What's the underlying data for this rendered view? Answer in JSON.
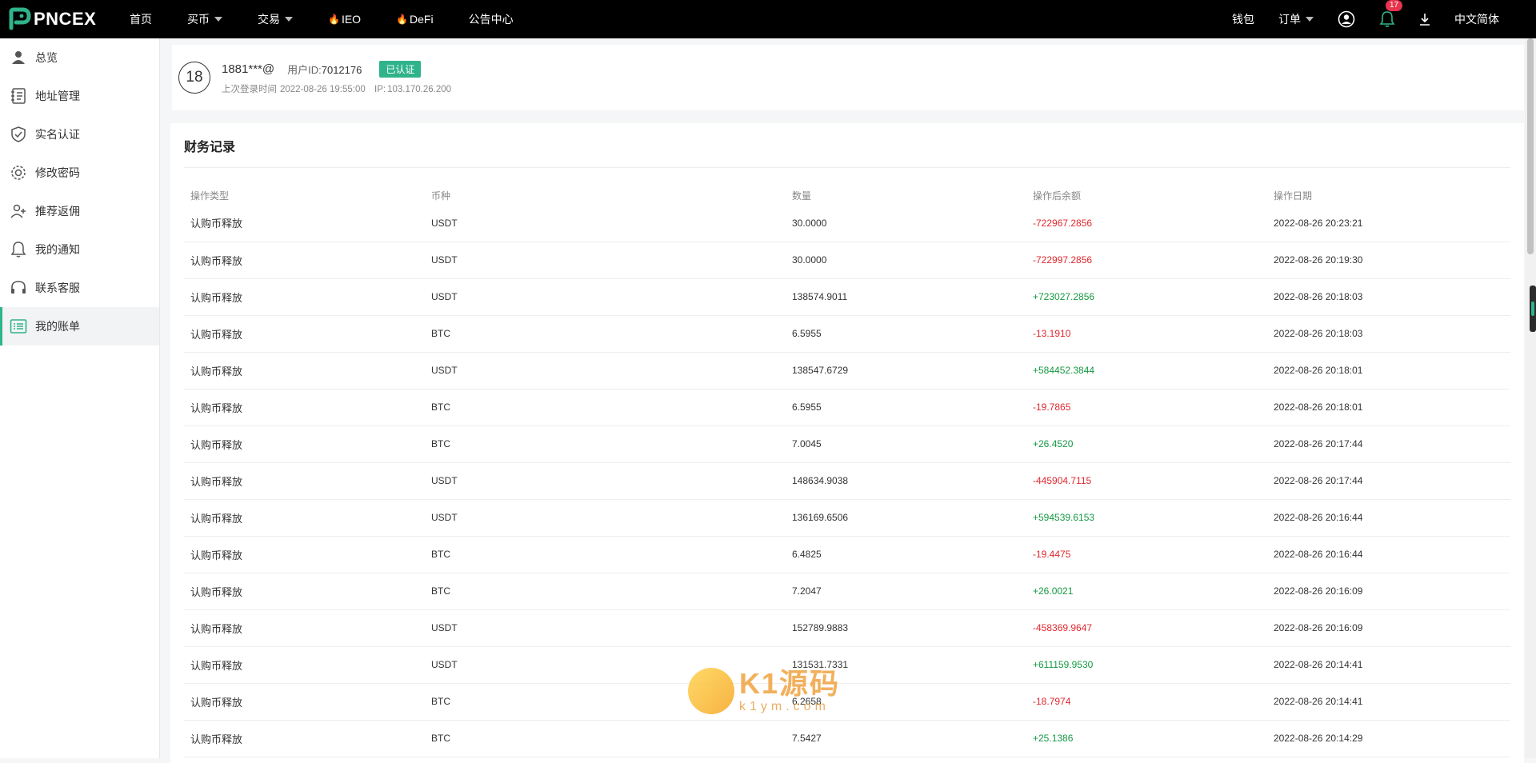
{
  "brand": {
    "name": "PNCEX",
    "accent": "#2fb38a"
  },
  "nav": {
    "items": [
      {
        "label": "首页",
        "caret": false,
        "flame": false
      },
      {
        "label": "买币",
        "caret": true,
        "flame": false
      },
      {
        "label": "交易",
        "caret": true,
        "flame": false
      },
      {
        "label": "IEO",
        "caret": false,
        "flame": true
      },
      {
        "label": "DeFi",
        "caret": false,
        "flame": true
      },
      {
        "label": "公告中心",
        "caret": false,
        "flame": false
      }
    ],
    "right": {
      "wallet": "钱包",
      "orders": "订单",
      "notification_count": "17",
      "language": "中文简体"
    }
  },
  "sidebar": {
    "items": [
      {
        "label": "总览",
        "icon": "user-icon",
        "active": false
      },
      {
        "label": "地址管理",
        "icon": "address-book-icon",
        "active": false
      },
      {
        "label": "实名认证",
        "icon": "shield-check-icon",
        "active": false
      },
      {
        "label": "修改密码",
        "icon": "gear-icon",
        "active": false
      },
      {
        "label": "推荐返佣",
        "icon": "user-plus-icon",
        "active": false
      },
      {
        "label": "我的通知",
        "icon": "bell-icon",
        "active": false
      },
      {
        "label": "联系客服",
        "icon": "headset-icon",
        "active": false
      },
      {
        "label": "我的账单",
        "icon": "list-icon",
        "active": true
      }
    ]
  },
  "profile": {
    "avatar_text": "18",
    "username": "1881***@",
    "uid_label": "用户ID:",
    "uid": "7012176",
    "verified": "已认证",
    "last_login_label": "上次登录时间",
    "last_login": "2022-08-26 19:55:00",
    "ip_label": "IP:",
    "ip": "103.170.26.200"
  },
  "records": {
    "title": "财务记录",
    "columns": [
      "操作类型",
      "币种",
      "数量",
      "操作后余额",
      "操作日期"
    ],
    "rows": [
      {
        "type": "认购币释放",
        "coin": "USDT",
        "amount": "30.0000",
        "balance": "-722967.2856",
        "date": "2022-08-26 20:23:21"
      },
      {
        "type": "认购币释放",
        "coin": "USDT",
        "amount": "30.0000",
        "balance": "-722997.2856",
        "date": "2022-08-26 20:19:30"
      },
      {
        "type": "认购币释放",
        "coin": "USDT",
        "amount": "138574.9011",
        "balance": "+723027.2856",
        "date": "2022-08-26 20:18:03"
      },
      {
        "type": "认购币释放",
        "coin": "BTC",
        "amount": "6.5955",
        "balance": "-13.1910",
        "date": "2022-08-26 20:18:03"
      },
      {
        "type": "认购币释放",
        "coin": "USDT",
        "amount": "138547.6729",
        "balance": "+584452.3844",
        "date": "2022-08-26 20:18:01"
      },
      {
        "type": "认购币释放",
        "coin": "BTC",
        "amount": "6.5955",
        "balance": "-19.7865",
        "date": "2022-08-26 20:18:01"
      },
      {
        "type": "认购币释放",
        "coin": "BTC",
        "amount": "7.0045",
        "balance": "+26.4520",
        "date": "2022-08-26 20:17:44"
      },
      {
        "type": "认购币释放",
        "coin": "USDT",
        "amount": "148634.9038",
        "balance": "-445904.7115",
        "date": "2022-08-26 20:17:44"
      },
      {
        "type": "认购币释放",
        "coin": "USDT",
        "amount": "136169.6506",
        "balance": "+594539.6153",
        "date": "2022-08-26 20:16:44"
      },
      {
        "type": "认购币释放",
        "coin": "BTC",
        "amount": "6.4825",
        "balance": "-19.4475",
        "date": "2022-08-26 20:16:44"
      },
      {
        "type": "认购币释放",
        "coin": "BTC",
        "amount": "7.2047",
        "balance": "+26.0021",
        "date": "2022-08-26 20:16:09"
      },
      {
        "type": "认购币释放",
        "coin": "USDT",
        "amount": "152789.9883",
        "balance": "-458369.9647",
        "date": "2022-08-26 20:16:09"
      },
      {
        "type": "认购币释放",
        "coin": "USDT",
        "amount": "131531.7331",
        "balance": "+611159.9530",
        "date": "2022-08-26 20:14:41"
      },
      {
        "type": "认购币释放",
        "coin": "BTC",
        "amount": "6.2658",
        "balance": "-18.7974",
        "date": "2022-08-26 20:14:41"
      },
      {
        "type": "认购币释放",
        "coin": "BTC",
        "amount": "7.5427",
        "balance": "+25.1386",
        "date": "2022-08-26 20:14:29"
      }
    ]
  },
  "watermark": {
    "big": "K1源码",
    "small": "k1ym.com"
  }
}
